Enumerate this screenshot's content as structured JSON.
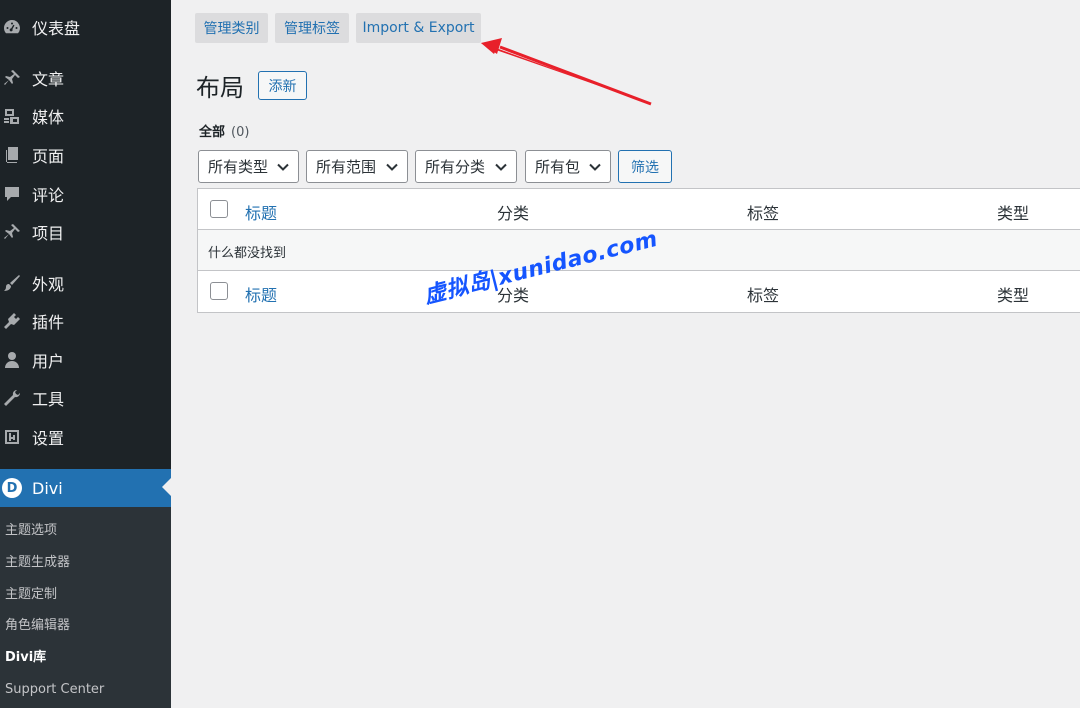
{
  "sidebar": {
    "items": [
      {
        "label": "仪表盘",
        "icon": "dashboard-icon"
      },
      {
        "label": "文章",
        "icon": "pin-icon"
      },
      {
        "label": "媒体",
        "icon": "media-icon"
      },
      {
        "label": "页面",
        "icon": "page-icon"
      },
      {
        "label": "评论",
        "icon": "comment-icon"
      },
      {
        "label": "项目",
        "icon": "pin-icon"
      },
      {
        "label": "外观",
        "icon": "brush-icon"
      },
      {
        "label": "插件",
        "icon": "plugin-icon"
      },
      {
        "label": "用户",
        "icon": "user-icon"
      },
      {
        "label": "工具",
        "icon": "wrench-icon"
      },
      {
        "label": "设置",
        "icon": "settings-icon"
      },
      {
        "label": "Divi",
        "icon": "divi-logo-icon",
        "logo_letter": "D"
      }
    ],
    "submenu": [
      {
        "label": "主题选项"
      },
      {
        "label": "主题生成器"
      },
      {
        "label": "主题定制"
      },
      {
        "label": "角色编辑器"
      },
      {
        "label": "Divi库",
        "current": true
      },
      {
        "label": "Support Center"
      }
    ]
  },
  "tabs": [
    {
      "label": "管理类别"
    },
    {
      "label": "管理标签"
    },
    {
      "label": "Import & Export"
    }
  ],
  "page": {
    "title": "布局",
    "add_new": "添新"
  },
  "views": {
    "all_label": "全部",
    "all_count": "(0)"
  },
  "filters": {
    "selects": [
      {
        "value": "所有类型"
      },
      {
        "value": "所有范围"
      },
      {
        "value": "所有分类"
      },
      {
        "value": "所有包"
      }
    ],
    "button": "筛选"
  },
  "table": {
    "columns": [
      "标题",
      "分类",
      "标签",
      "类型"
    ],
    "empty_message": "什么都没找到"
  },
  "watermark": "虚拟岛|xunidao.com",
  "colors": {
    "sidebar_bg": "#1d2327",
    "accent": "#2271b1",
    "annotation_arrow": "#e8202a",
    "watermark": "#1555ff"
  }
}
